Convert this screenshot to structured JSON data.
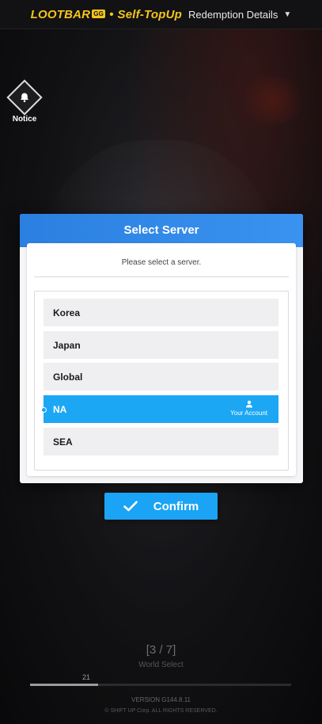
{
  "topbar": {
    "brand_name": "LOOTBAR",
    "brand_tag": "GG",
    "brand_separator": "•",
    "brand_product": "Self-TopUp",
    "redemption_label": "Redemption Details",
    "caret_icon": "chevron-down-icon"
  },
  "notice": {
    "label": "Notice",
    "icon": "bell-icon"
  },
  "dialog": {
    "title": "Select Server",
    "subtitle": "Please select a server.",
    "servers": [
      {
        "name": "Korea",
        "selected": false
      },
      {
        "name": "Japan",
        "selected": false
      },
      {
        "name": "Global",
        "selected": false
      },
      {
        "name": "NA",
        "selected": true,
        "badge": "Your Account",
        "badge_icon": "user-icon"
      },
      {
        "name": "SEA",
        "selected": false
      }
    ]
  },
  "confirm": {
    "label": "Confirm",
    "icon": "check-icon"
  },
  "footer": {
    "step": "[3 / 7]",
    "step_label": "World Select",
    "progress_value": "21",
    "progress_fraction": 0.26,
    "version": "VERSION  G144.8.11",
    "copyright": "© SHIFT UP Corp. ALL RIGHTS RESERVED."
  },
  "colors": {
    "accent": "#1ba4f5",
    "brand": "#f4c51b",
    "header_blue": "#2b7fe0"
  }
}
